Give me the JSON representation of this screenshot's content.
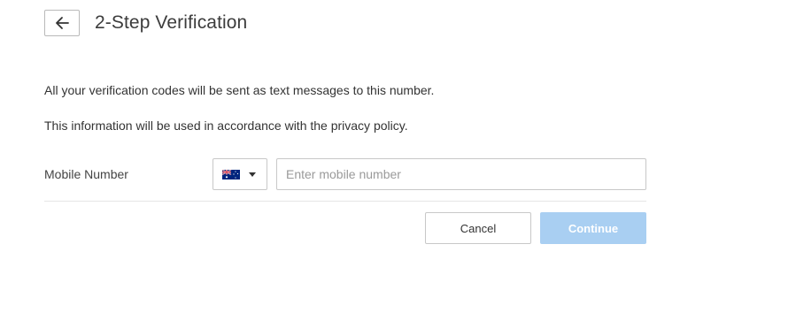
{
  "header": {
    "title": "2-Step Verification",
    "back_icon": "arrow-left-icon"
  },
  "body": {
    "line1": "All your verification codes will be sent as text messages to this number.",
    "line2": "This information will be used in accordance with the privacy policy."
  },
  "form": {
    "mobile_label": "Mobile Number",
    "country_flag_icon": "australia-flag-icon",
    "country_caret_icon": "caret-down-icon",
    "mobile_value": "",
    "mobile_placeholder": "Enter mobile number"
  },
  "actions": {
    "cancel_label": "Cancel",
    "continue_label": "Continue",
    "continue_color": "#a9cff2"
  }
}
